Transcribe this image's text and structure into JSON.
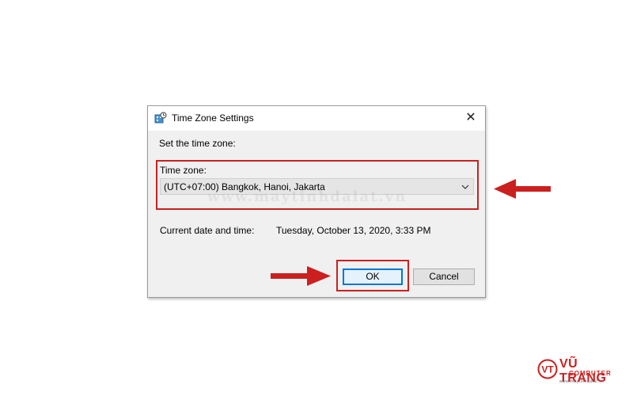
{
  "dialog": {
    "title": "Time Zone Settings",
    "title_icon": "clock-globe-icon",
    "close_glyph": "✕",
    "instruction": "Set the time zone:",
    "time_zone_label": "Time zone:",
    "time_zone_value": "(UTC+07:00) Bangkok, Hanoi, Jakarta",
    "current_label": "Current date and time:",
    "current_value": "Tuesday, October 13, 2020, 3:33 PM",
    "ok_label": "OK",
    "cancel_label": "Cancel"
  },
  "annotations": {
    "highlight_color": "#cc1f1f",
    "arrow_color": "#cc1f1f"
  },
  "watermark": "www.maytinhdalat.vn",
  "logo": {
    "name": "VŨ TRANG",
    "subtitle": "COMPUTER",
    "url": "www.maytinhdalat.vn",
    "monogram": "VT"
  }
}
